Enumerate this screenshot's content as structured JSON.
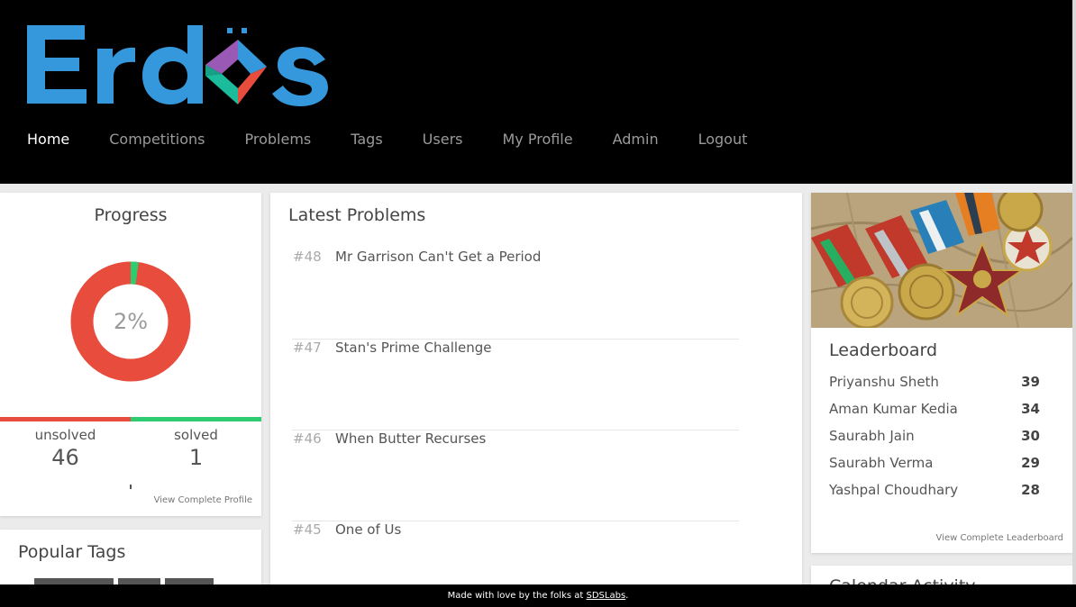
{
  "brand": {
    "logo_text": "Erdős",
    "colors": {
      "blue": "#3598dc",
      "red": "#e74c3c",
      "green": "#2ecc71",
      "purple": "#9b59b6"
    }
  },
  "nav": {
    "items": [
      {
        "label": "Home",
        "active": true
      },
      {
        "label": "Competitions",
        "active": false
      },
      {
        "label": "Problems",
        "active": false
      },
      {
        "label": "Tags",
        "active": false
      },
      {
        "label": "Users",
        "active": false
      },
      {
        "label": "My Profile",
        "active": false
      },
      {
        "label": "Admin",
        "active": false
      },
      {
        "label": "Logout",
        "active": false
      }
    ]
  },
  "progress": {
    "title": "Progress",
    "percent_label": "2%",
    "solved_fraction": 0.0213,
    "unsolved_label": "unsolved",
    "unsolved_count": "46",
    "solved_label": "solved",
    "solved_count": "1",
    "view_profile_link": "View Complete Profile",
    "colors": {
      "unsolved": "#e74c3c",
      "solved": "#2ecc71"
    }
  },
  "popular_tags": {
    "title": "Popular Tags"
  },
  "latest_problems": {
    "title": "Latest Problems",
    "items": [
      {
        "number": "#48",
        "title": "Mr Garrison Can't Get a Period"
      },
      {
        "number": "#47",
        "title": "Stan's Prime Challenge"
      },
      {
        "number": "#46",
        "title": "When Butter Recurses"
      },
      {
        "number": "#45",
        "title": "One of Us"
      }
    ]
  },
  "leaderboard": {
    "title": "Leaderboard",
    "rows": [
      {
        "name": "Priyanshu Sheth",
        "score": "39"
      },
      {
        "name": "Aman Kumar Kedia",
        "score": "34"
      },
      {
        "name": "Saurabh Jain",
        "score": "30"
      },
      {
        "name": "Saurabh Verma",
        "score": "29"
      },
      {
        "name": "Yashpal Choudhary",
        "score": "28"
      }
    ],
    "view_link": "View Complete Leaderboard"
  },
  "calendar": {
    "title": "Calendar Activity"
  },
  "footer": {
    "text": "Made with love by the folks at ",
    "link": "SDSLabs",
    "suffix": "."
  }
}
